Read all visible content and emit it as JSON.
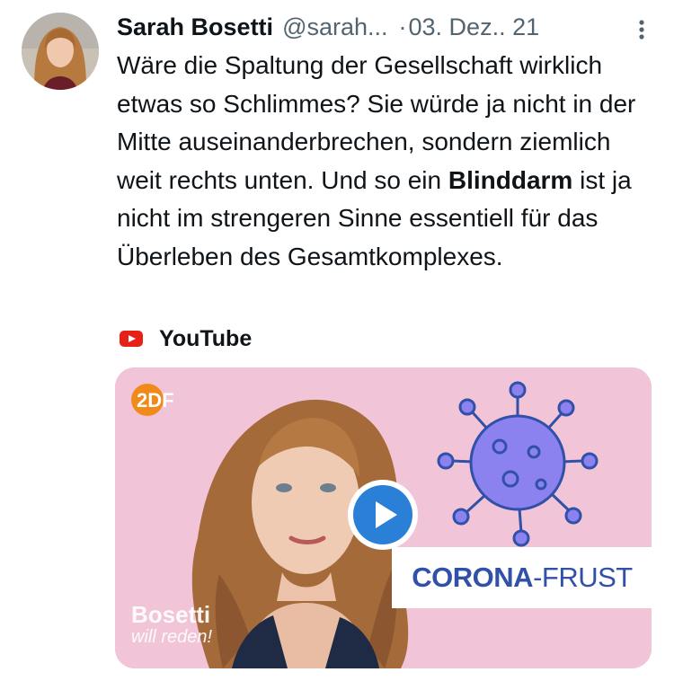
{
  "author": {
    "name": "Sarah Bosetti",
    "handle": "@sarah...",
    "separator": "·",
    "date": "03. Dez.. 21"
  },
  "tweet": {
    "text_before": "Wäre die Spaltung der Gesellschaft wirklich etwas so Schlimmes? Sie würde ja nicht in der Mitte auseinanderbrechen, sondern ziemlich weit rechts unten. Und so ein ",
    "text_bold": "Blinddarm",
    "text_after": " ist ja nicht im strengeren Sinne essentiell für das Überleben des Gesamtkomplexes."
  },
  "link_source": {
    "label": "YouTube",
    "icon": "youtube-icon"
  },
  "video_card": {
    "channel_logo_text": "2DF",
    "banner_bold": "CORONA",
    "banner_rest": "-FRUST",
    "show_title": "Bosetti",
    "show_subtitle": "will reden!",
    "play_icon": "play-icon",
    "background_color": "#f2c4d8",
    "banner_text_color": "#3150a8",
    "virus_color": "#8b82f0",
    "zdf_color": "#f08a1a"
  },
  "colors": {
    "text_primary": "#0f1419",
    "text_secondary": "#536471",
    "youtube_red": "#e62117",
    "play_blue": "#2a7fd6"
  }
}
